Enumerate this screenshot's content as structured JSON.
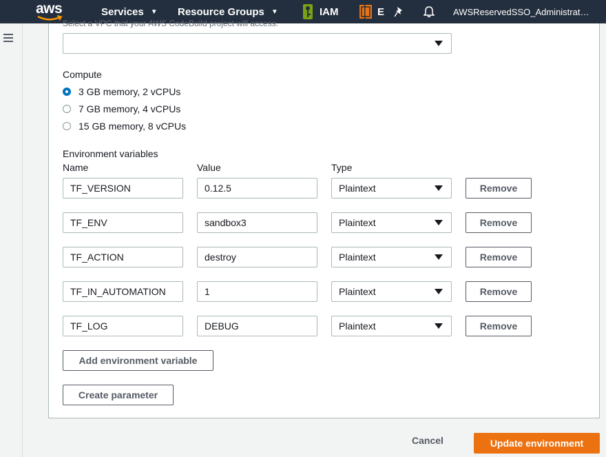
{
  "nav": {
    "logo": "aws",
    "services": "Services",
    "resource_groups": "Resource Groups",
    "iam": "IAM",
    "ec2_short": "E",
    "user": "AWSReservedSSO_Administrat…",
    "icons": [
      "iam-key-icon",
      "ec2-icon",
      "pin-icon",
      "bell-icon"
    ]
  },
  "vpc": {
    "helper_text": "Select a VPC that your AWS CodeBuild project will access.",
    "selected": ""
  },
  "compute": {
    "label": "Compute",
    "options": [
      {
        "label": "3 GB memory, 2 vCPUs",
        "checked": true
      },
      {
        "label": "7 GB memory, 4 vCPUs",
        "checked": false
      },
      {
        "label": "15 GB memory, 8 vCPUs",
        "checked": false
      }
    ]
  },
  "env": {
    "label": "Environment variables",
    "col_name": "Name",
    "col_value": "Value",
    "col_type": "Type",
    "remove_label": "Remove",
    "rows": [
      {
        "name": "TF_VERSION",
        "value": "0.12.5",
        "type": "Plaintext"
      },
      {
        "name": "TF_ENV",
        "value": "sandbox3",
        "type": "Plaintext"
      },
      {
        "name": "TF_ACTION",
        "value": "destroy",
        "type": "Plaintext"
      },
      {
        "name": "TF_IN_AUTOMATION",
        "value": "1",
        "type": "Plaintext"
      },
      {
        "name": "TF_LOG",
        "value": "DEBUG",
        "type": "Plaintext"
      }
    ],
    "add_label": "Add environment variable",
    "create_param_label": "Create parameter"
  },
  "footer": {
    "cancel": "Cancel",
    "update": "Update environment"
  },
  "colors": {
    "nav_bg": "#232f3e",
    "primary": "#ec7211",
    "radio_checked": "#0073bb"
  }
}
